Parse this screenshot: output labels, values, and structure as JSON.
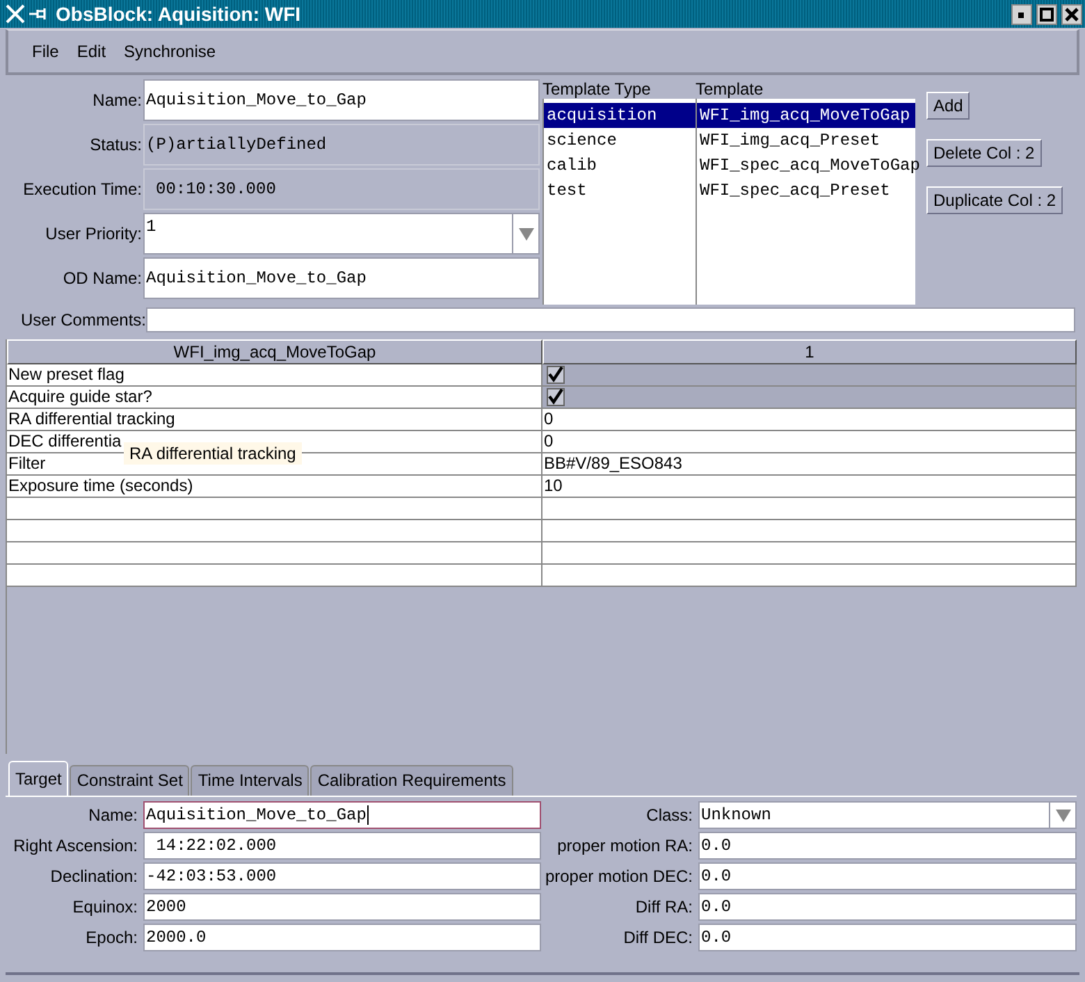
{
  "window": {
    "title": "ObsBlock: Aquisition: WFI"
  },
  "menu": [
    "File",
    "Edit",
    "Synchronise"
  ],
  "form": {
    "name": {
      "label": "Name:",
      "value": "Aquisition_Move_to_Gap"
    },
    "status": {
      "label": "Status:",
      "value": "(P)artiallyDefined"
    },
    "execution_time": {
      "label": "Execution Time:",
      "value": "00:10:30.000"
    },
    "user_priority": {
      "label": "User Priority:",
      "value": "1"
    },
    "od_name": {
      "label": "OD Name:",
      "value": "Aquisition_Move_to_Gap"
    },
    "user_comments": {
      "label": "User Comments:"
    }
  },
  "template_types": {
    "heading": "Template Type",
    "items": [
      {
        "label": "acquisition",
        "selected": true
      },
      {
        "label": "science",
        "selected": false
      },
      {
        "label": "calib",
        "selected": false
      },
      {
        "label": "test",
        "selected": false
      }
    ]
  },
  "templates": {
    "heading": "Template",
    "items": [
      {
        "label": "WFI_img_acq_MoveToGap",
        "selected": true
      },
      {
        "label": "WFI_img_acq_Preset",
        "selected": false
      },
      {
        "label": "WFI_spec_acq_MoveToGap",
        "selected": false
      },
      {
        "label": "WFI_spec_acq_Preset",
        "selected": false
      }
    ]
  },
  "buttons": [
    "Add",
    "Delete Col : 2",
    "Duplicate Col : 2"
  ],
  "table": {
    "columns": [
      "WFI_img_acq_MoveToGap",
      "1"
    ],
    "rows": [
      {
        "label": "New preset flag",
        "kind": "checkbox",
        "checked": true
      },
      {
        "label": "Acquire guide star?",
        "kind": "checkbox",
        "checked": true
      },
      {
        "label": "RA differential tracking",
        "kind": "text",
        "value": "0"
      },
      {
        "label": "DEC differentia",
        "kind": "text",
        "value": "0"
      },
      {
        "label": "Filter",
        "kind": "text",
        "value": "BB#V/89_ESO843"
      },
      {
        "label": "Exposure time (seconds)",
        "kind": "text",
        "value": "10"
      }
    ]
  },
  "tooltip": {
    "text": "RA differential tracking"
  },
  "tabs": [
    {
      "label": "Target",
      "selected": true
    },
    {
      "label": "Constraint Set",
      "selected": false
    },
    {
      "label": "Time Intervals",
      "selected": false
    },
    {
      "label": "Calibration Requirements",
      "selected": false
    }
  ],
  "target": {
    "left": [
      {
        "label": "Name:",
        "value": "Aquisition_Move_to_Gap",
        "focused": true
      },
      {
        "label": "Right Ascension:",
        "value": " 14:22:02.000",
        "focused": false
      },
      {
        "label": "Declination:",
        "value": "-42:03:53.000",
        "focused": false
      },
      {
        "label": "Equinox:",
        "value": "2000",
        "focused": false
      },
      {
        "label": "Epoch:",
        "value": "2000.0",
        "focused": false
      }
    ],
    "right": [
      {
        "label": "Class:",
        "value": "Unknown",
        "kind": "dropdown"
      },
      {
        "label": "proper motion RA:",
        "value": "0.0",
        "kind": "text"
      },
      {
        "label": "proper motion DEC:",
        "value": "0.0",
        "kind": "text"
      },
      {
        "label": "Diff RA:",
        "value": "0.0",
        "kind": "text"
      },
      {
        "label": "Diff DEC:",
        "value": "0.0",
        "kind": "text"
      }
    ]
  }
}
